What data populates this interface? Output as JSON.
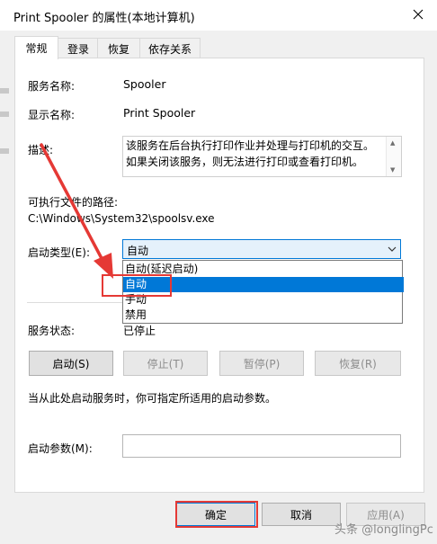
{
  "window": {
    "title": "Print Spooler 的属性(本地计算机)",
    "close_glyph": "✕"
  },
  "tabs": [
    {
      "label": "常规",
      "active": true
    },
    {
      "label": "登录",
      "active": false
    },
    {
      "label": "恢复",
      "active": false
    },
    {
      "label": "依存关系",
      "active": false
    }
  ],
  "general": {
    "service_name_label": "服务名称:",
    "service_name_value": "Spooler",
    "display_name_label": "显示名称:",
    "display_name_value": "Print Spooler",
    "description_label": "描述:",
    "description_text": "该服务在后台执行打印作业并处理与打印机的交互。如果关闭该服务，则无法进行打印或查看打印机。",
    "exe_path_label": "可执行文件的路径:",
    "exe_path_value": "C:\\Windows\\System32\\spoolsv.exe",
    "startup_type_label": "启动类型(E):",
    "startup_type_selected": "自动",
    "startup_type_options": [
      "自动(延迟启动)",
      "自动",
      "手动",
      "禁用"
    ],
    "highlighted_option_index": 1,
    "service_status_label": "服务状态:",
    "service_status_value": "已停止",
    "start_button": "启动(S)",
    "stop_button": "停止(T)",
    "pause_button": "暂停(P)",
    "resume_button": "恢复(R)",
    "hint_text": "当从此处启动服务时，你可指定所适用的启动参数。",
    "start_params_label": "启动参数(M):",
    "start_params_value": ""
  },
  "footer": {
    "ok_button": "确定",
    "cancel_button": "取消",
    "apply_button": "应用(A)"
  },
  "watermark": "头条 @longlingPc",
  "colors": {
    "accent": "#0078d7",
    "annotation_red": "#e53935",
    "dialog_bg": "#f0f0f0"
  }
}
